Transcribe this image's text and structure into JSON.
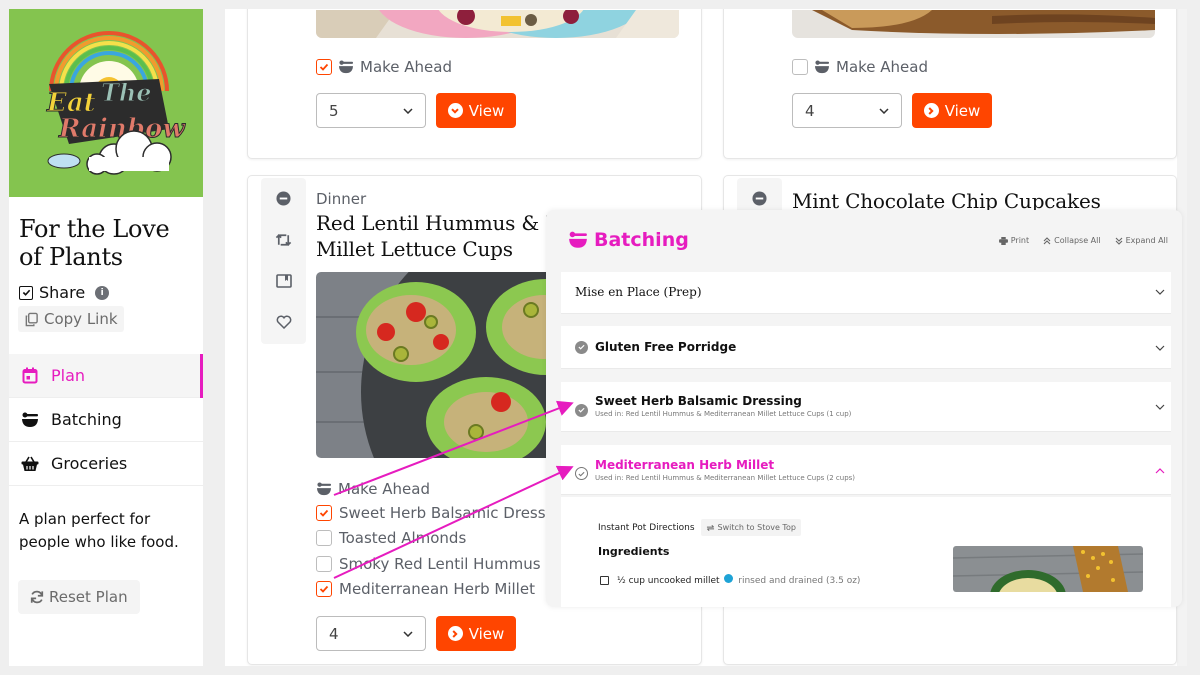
{
  "sidebar": {
    "logo_alt": "Eat The Rainbow",
    "plan_title": "For the Love of Plants",
    "share_label": "Share",
    "share_checked": true,
    "copy_link_label": "Copy Link",
    "nav": [
      {
        "label": "Plan",
        "icon": "calendar-icon",
        "active": true
      },
      {
        "label": "Batching",
        "icon": "bowl-icon",
        "active": false
      },
      {
        "label": "Groceries",
        "icon": "basket-icon",
        "active": false
      }
    ],
    "description": "A plan perfect for people who like food.",
    "reset_label": "Reset Plan"
  },
  "cards": [
    {
      "make_ahead_label": "Make Ahead",
      "make_ahead_checked": true,
      "servings": "5",
      "view_label": "View"
    },
    {
      "make_ahead_label": "Make Ahead",
      "make_ahead_checked": false,
      "servings": "4",
      "view_label": "View"
    },
    {
      "meal_type": "Dinner",
      "title": "Red Lentil Hummus & Mediterranean Millet Lettuce Cups",
      "title_line1": "Red Lentil Hummus & Me",
      "title_line2": "Millet Lettuce Cups",
      "make_ahead_label": "Make Ahead",
      "make_ahead_items": [
        {
          "label": "Sweet Herb Balsamic Dressing",
          "checked": true
        },
        {
          "label": "Toasted Almonds",
          "checked": false
        },
        {
          "label": "Smoky Red Lentil Hummus",
          "checked": false
        },
        {
          "label": "Mediterranean Herb Millet",
          "checked": true
        }
      ],
      "servings": "4",
      "view_label": "View"
    },
    {
      "title": "Mint Chocolate Chip Cupcakes"
    }
  ],
  "batching": {
    "title": "Batching",
    "tools": {
      "print": "Print",
      "collapse_all": "Collapse All",
      "expand_all": "Expand All"
    },
    "sections": [
      {
        "title": "Mise en Place (Prep)",
        "expanded": false
      },
      {
        "title": "Gluten Free Porridge",
        "done": true,
        "expanded": false
      },
      {
        "title": "Sweet Herb Balsamic Dressing",
        "subtitle": "Used in: Red Lentil Hummus & Mediterranean Millet Lettuce Cups (1 cup)",
        "done": true,
        "expanded": false
      },
      {
        "title": "Mediterranean Herb Millet",
        "subtitle": "Used in: Red Lentil Hummus & Mediterranean Millet Lettuce Cups (2 cups)",
        "done": false,
        "expanded": true
      }
    ],
    "directions_label": "Instant Pot Directions",
    "switch_label": "Switch to Stove Top",
    "ingredients_heading": "Ingredients",
    "ingredients": [
      {
        "amount": "½ cup uncooked millet",
        "note": "rinsed and drained (3.5 oz)"
      }
    ]
  },
  "colors": {
    "accent": "#e61cbf",
    "action": "#ff4500",
    "logo_bg": "#84c44f"
  }
}
